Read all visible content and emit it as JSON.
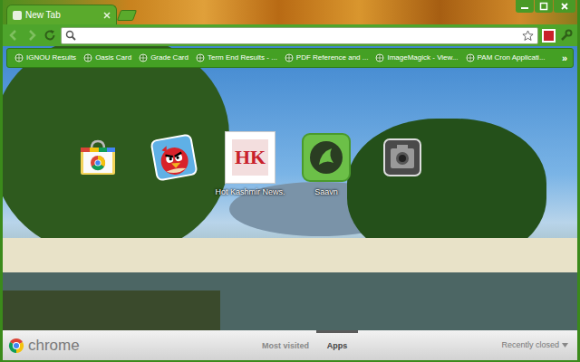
{
  "window": {
    "tabs": [
      {
        "label": "New Tab",
        "selected": true
      }
    ]
  },
  "bookmarks_bar": {
    "items": [
      {
        "label": "IGNOU Results"
      },
      {
        "label": "Oasis Card"
      },
      {
        "label": "Grade Card"
      },
      {
        "label": "Term End Results - ..."
      },
      {
        "label": "PDF Reference and ..."
      },
      {
        "label": "ImageMagick - View..."
      },
      {
        "label": "PAM Cron Applicati..."
      }
    ],
    "overflow": "»"
  },
  "apps": [
    {
      "kind": "webstore"
    },
    {
      "kind": "angrybirds"
    },
    {
      "kind": "hotkashmir",
      "icon_text": "HK",
      "label": "Hot Kashmir News."
    },
    {
      "kind": "saavn",
      "label": "Saavn"
    },
    {
      "kind": "camera"
    }
  ],
  "footer": {
    "logo_text": "chrome",
    "sections": [
      {
        "label": "Most visited",
        "selected": false
      },
      {
        "label": "Apps",
        "selected": true
      }
    ],
    "recently_closed": "Recently closed"
  }
}
